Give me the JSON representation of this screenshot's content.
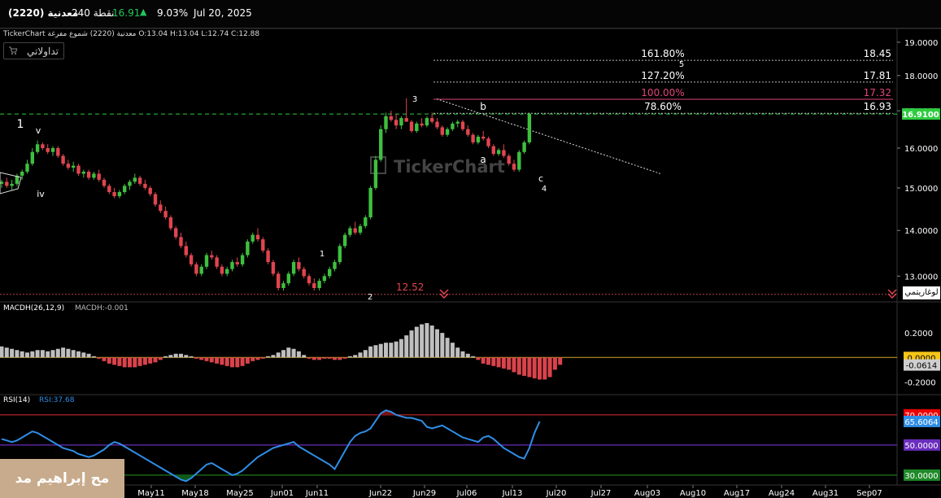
{
  "topbar": {
    "symbol": "معدنية (2220)",
    "volume": "240 نقطة",
    "price": "16.91",
    "change_pct": "9.03%",
    "date": "Jul 20, 2025",
    "up_color": "#22c55e"
  },
  "header": {
    "info": "TickerChart معدنية (2220) شموع مفرغة  O:13.04  H:13.04  L:12.74  C:12.88"
  },
  "toolbar": {
    "trading_button": "تداولاتي"
  },
  "log_button": "لوغاريتمي",
  "watermark": "TickerChart",
  "author_badge": "مح إبراهيم مد",
  "colors": {
    "bull": "#3fbf3f",
    "bear": "#e0454f",
    "macd_pos": "#bfbfbf",
    "macd_neg": "#d9434b",
    "rsi": "#2f8ee6",
    "price_badge": "#2ecc40",
    "fib_pink": "#e0457a"
  },
  "chart_data": [
    {
      "type": "candlestick",
      "panel": "price",
      "scale": "log",
      "ylim": [
        12.55,
        19.3
      ],
      "ytick_labels": [
        "19.0000",
        "18.0000",
        "17.0000",
        "16.0000",
        "15.0000",
        "14.0000",
        "13.0000"
      ],
      "ytick_values": [
        19,
        18,
        17,
        16,
        15,
        14,
        13
      ],
      "current_price_label": "16.9100",
      "current_price": 16.91,
      "low_label": "12.52",
      "xtick_labels": [
        "May11",
        "May18",
        "May25",
        "Jun01",
        "Jun11",
        "Jun22",
        "Jun29",
        "Jul06",
        "Jul13",
        "Jul20",
        "Jul27",
        "Aug03",
        "Aug10",
        "Aug17",
        "Aug24",
        "Aug31",
        "Sep07"
      ],
      "fib_levels": [
        {
          "pct": "161.80%",
          "value": "18.45",
          "y": 18.45
        },
        {
          "pct": "127.20%",
          "value": "17.81",
          "y": 17.81
        },
        {
          "pct": "100.00%",
          "value": "17.32",
          "y": 17.32
        },
        {
          "pct": "78.60%",
          "value": "16.93",
          "y": 16.93
        }
      ],
      "wave_labels": [
        "1",
        "v",
        "iv",
        "1",
        "2",
        "3",
        "b",
        "a",
        "c",
        "4",
        "5"
      ],
      "candles": [
        [
          15.1,
          15.2,
          15.0,
          15.15
        ],
        [
          15.15,
          15.25,
          15.0,
          15.05
        ],
        [
          15.05,
          15.2,
          14.95,
          15.1
        ],
        [
          15.1,
          15.35,
          15.05,
          15.3
        ],
        [
          15.3,
          15.45,
          15.2,
          15.4
        ],
        [
          15.4,
          15.7,
          15.35,
          15.6
        ],
        [
          15.6,
          16.0,
          15.55,
          15.9
        ],
        [
          15.9,
          16.2,
          15.85,
          16.1
        ],
        [
          16.1,
          16.15,
          15.95,
          16.0
        ],
        [
          16.0,
          16.1,
          15.85,
          15.9
        ],
        [
          15.9,
          16.05,
          15.8,
          16.0
        ],
        [
          16.0,
          16.05,
          15.75,
          15.8
        ],
        [
          15.8,
          15.85,
          15.55,
          15.6
        ],
        [
          15.6,
          15.7,
          15.45,
          15.5
        ],
        [
          15.5,
          15.65,
          15.4,
          15.55
        ],
        [
          15.55,
          15.6,
          15.3,
          15.35
        ],
        [
          15.35,
          15.45,
          15.25,
          15.4
        ],
        [
          15.4,
          15.45,
          15.2,
          15.25
        ],
        [
          15.25,
          15.4,
          15.2,
          15.35
        ],
        [
          15.35,
          15.45,
          15.15,
          15.2
        ],
        [
          15.2,
          15.25,
          15.0,
          15.05
        ],
        [
          15.05,
          15.1,
          14.85,
          14.9
        ],
        [
          14.9,
          15.0,
          14.75,
          14.8
        ],
        [
          14.8,
          14.95,
          14.75,
          14.9
        ],
        [
          14.9,
          15.1,
          14.85,
          15.05
        ],
        [
          15.05,
          15.2,
          14.95,
          15.15
        ],
        [
          15.15,
          15.35,
          15.1,
          15.25
        ],
        [
          15.25,
          15.3,
          15.05,
          15.1
        ],
        [
          15.1,
          15.2,
          14.95,
          15.0
        ],
        [
          15.0,
          15.05,
          14.8,
          14.85
        ],
        [
          14.85,
          14.9,
          14.55,
          14.6
        ],
        [
          14.6,
          14.7,
          14.4,
          14.45
        ],
        [
          14.45,
          14.55,
          14.25,
          14.3
        ],
        [
          14.3,
          14.35,
          14.0,
          14.05
        ],
        [
          14.05,
          14.1,
          13.8,
          13.85
        ],
        [
          13.85,
          13.95,
          13.6,
          13.65
        ],
        [
          13.65,
          13.75,
          13.4,
          13.45
        ],
        [
          13.45,
          13.5,
          13.2,
          13.25
        ],
        [
          13.25,
          13.3,
          13.0,
          13.05
        ],
        [
          13.05,
          13.25,
          13.0,
          13.2
        ],
        [
          13.2,
          13.5,
          13.15,
          13.45
        ],
        [
          13.45,
          13.55,
          13.35,
          13.4
        ],
        [
          13.4,
          13.45,
          13.15,
          13.2
        ],
        [
          13.2,
          13.25,
          13.0,
          13.05
        ],
        [
          13.05,
          13.2,
          13.0,
          13.15
        ],
        [
          13.15,
          13.35,
          13.1,
          13.3
        ],
        [
          13.3,
          13.4,
          13.2,
          13.25
        ],
        [
          13.25,
          13.5,
          13.2,
          13.45
        ],
        [
          13.45,
          13.8,
          13.4,
          13.75
        ],
        [
          13.75,
          13.95,
          13.7,
          13.9
        ],
        [
          13.9,
          14.05,
          13.75,
          13.8
        ],
        [
          13.8,
          13.85,
          13.5,
          13.55
        ],
        [
          13.55,
          13.6,
          13.25,
          13.3
        ],
        [
          13.3,
          13.35,
          13.0,
          13.05
        ],
        [
          13.05,
          13.1,
          12.7,
          12.75
        ],
        [
          12.75,
          12.9,
          12.7,
          12.85
        ],
        [
          12.85,
          13.1,
          12.8,
          13.05
        ],
        [
          13.05,
          13.35,
          13.0,
          13.3
        ],
        [
          13.3,
          13.4,
          13.1,
          13.15
        ],
        [
          13.15,
          13.2,
          12.95,
          13.0
        ],
        [
          13.0,
          13.05,
          12.8,
          12.85
        ],
        [
          12.85,
          12.95,
          12.7,
          12.75
        ],
        [
          12.75,
          12.95,
          12.7,
          12.9
        ],
        [
          12.9,
          13.05,
          12.85,
          13.0
        ],
        [
          13.0,
          13.2,
          12.95,
          13.15
        ],
        [
          13.15,
          13.35,
          13.1,
          13.3
        ],
        [
          13.3,
          13.7,
          13.25,
          13.65
        ],
        [
          13.65,
          13.95,
          13.6,
          13.9
        ],
        [
          13.9,
          14.1,
          13.85,
          14.05
        ],
        [
          14.05,
          14.2,
          13.9,
          13.95
        ],
        [
          13.95,
          14.15,
          13.9,
          14.1
        ],
        [
          14.1,
          14.35,
          14.05,
          14.3
        ],
        [
          14.3,
          15.05,
          14.25,
          15.0
        ],
        [
          15.0,
          15.8,
          14.95,
          15.7
        ],
        [
          15.7,
          16.6,
          15.65,
          16.5
        ],
        [
          16.5,
          16.95,
          16.4,
          16.85
        ],
        [
          16.85,
          17.0,
          16.7,
          16.75
        ],
        [
          16.75,
          16.9,
          16.5,
          16.6
        ],
        [
          16.6,
          16.85,
          16.5,
          16.8
        ],
        [
          16.8,
          17.35,
          16.75,
          16.7
        ],
        [
          16.7,
          16.75,
          16.4,
          16.45
        ],
        [
          16.45,
          16.7,
          16.4,
          16.65
        ],
        [
          16.65,
          16.8,
          16.55,
          16.6
        ],
        [
          16.6,
          16.85,
          16.55,
          16.8
        ],
        [
          16.8,
          16.95,
          16.65,
          16.7
        ],
        [
          16.7,
          16.8,
          16.5,
          16.55
        ],
        [
          16.55,
          16.6,
          16.3,
          16.35
        ],
        [
          16.35,
          16.55,
          16.3,
          16.5
        ],
        [
          16.5,
          16.7,
          16.45,
          16.65
        ],
        [
          16.65,
          16.75,
          16.55,
          16.7
        ],
        [
          16.7,
          16.75,
          16.45,
          16.5
        ],
        [
          16.5,
          16.6,
          16.3,
          16.35
        ],
        [
          16.35,
          16.4,
          16.1,
          16.15
        ],
        [
          16.15,
          16.35,
          16.1,
          16.3
        ],
        [
          16.3,
          16.45,
          16.2,
          16.25
        ],
        [
          16.25,
          16.3,
          16.0,
          16.05
        ],
        [
          16.05,
          16.1,
          15.8,
          15.85
        ],
        [
          15.85,
          16.0,
          15.8,
          15.95
        ],
        [
          15.95,
          16.1,
          15.75,
          15.8
        ],
        [
          15.8,
          15.85,
          15.55,
          15.6
        ],
        [
          15.6,
          15.7,
          15.4,
          15.45
        ],
        [
          15.45,
          15.95,
          15.4,
          15.9
        ],
        [
          15.9,
          16.2,
          15.85,
          16.15
        ],
        [
          16.15,
          16.95,
          16.1,
          16.91
        ]
      ]
    },
    {
      "type": "bar",
      "panel": "macd",
      "title": "MACDH(26,12,9)",
      "value_label": "MACDH:-0.001",
      "ylim": [
        -0.27,
        0.34
      ],
      "ytick_labels": [
        "0.2000",
        "-0.2000"
      ],
      "ytick_values": [
        0.2,
        -0.2
      ],
      "zero_label": "0.0000",
      "last_label": "-0.0614",
      "values": [
        0.09,
        0.08,
        0.07,
        0.06,
        0.05,
        0.04,
        0.05,
        0.06,
        0.06,
        0.05,
        0.06,
        0.07,
        0.08,
        0.07,
        0.06,
        0.05,
        0.04,
        0.03,
        0.01,
        -0.01,
        -0.03,
        -0.05,
        -0.06,
        -0.07,
        -0.08,
        -0.08,
        -0.08,
        -0.07,
        -0.06,
        -0.05,
        -0.04,
        -0.02,
        0.01,
        0.02,
        0.03,
        0.03,
        0.02,
        0.01,
        -0.01,
        -0.02,
        -0.03,
        -0.04,
        -0.05,
        -0.06,
        -0.07,
        -0.08,
        -0.08,
        -0.07,
        -0.05,
        -0.03,
        -0.02,
        -0.01,
        0.01,
        0.02,
        0.04,
        0.06,
        0.08,
        0.07,
        0.05,
        0.02,
        -0.01,
        -0.02,
        -0.02,
        -0.01,
        -0.01,
        -0.02,
        -0.02,
        -0.01,
        0.01,
        0.02,
        0.04,
        0.06,
        0.09,
        0.1,
        0.11,
        0.12,
        0.12,
        0.13,
        0.15,
        0.18,
        0.22,
        0.25,
        0.27,
        0.28,
        0.26,
        0.23,
        0.2,
        0.16,
        0.12,
        0.08,
        0.05,
        0.03,
        0.01,
        -0.02,
        -0.05,
        -0.06,
        -0.07,
        -0.08,
        -0.09,
        -0.1,
        -0.12,
        -0.14,
        -0.15,
        -0.16,
        -0.17,
        -0.18,
        -0.18,
        -0.16,
        -0.1,
        -0.06
      ]
    },
    {
      "type": "line",
      "panel": "rsi",
      "title": "RSI(14)",
      "value_label": "RSI:37.68",
      "ylim": [
        24,
        78
      ],
      "ytick_labels": [
        "70.0000",
        "50.0000",
        "30.0000"
      ],
      "ytick_values": [
        70,
        50,
        30
      ],
      "last_label": "65.6064",
      "values": [
        54,
        53,
        52,
        53,
        55,
        57,
        59,
        58,
        56,
        54,
        52,
        50,
        48,
        47,
        46,
        44,
        43,
        42,
        43,
        45,
        47,
        50,
        52,
        51,
        49,
        47,
        45,
        43,
        41,
        39,
        37,
        35,
        33,
        31,
        29,
        27,
        26,
        28,
        31,
        34,
        37,
        38,
        36,
        34,
        32,
        30,
        31,
        33,
        36,
        39,
        42,
        44,
        46,
        48,
        49,
        50,
        51,
        52,
        49,
        47,
        45,
        43,
        41,
        39,
        37,
        34,
        40,
        46,
        52,
        56,
        58,
        59,
        61,
        66,
        71,
        73,
        72,
        70,
        69,
        68,
        68,
        67,
        66,
        62,
        61,
        62,
        63,
        61,
        59,
        57,
        55,
        54,
        53,
        52,
        55,
        56,
        54,
        51,
        48,
        46,
        44,
        42,
        41,
        48,
        58,
        65.6
      ]
    }
  ]
}
